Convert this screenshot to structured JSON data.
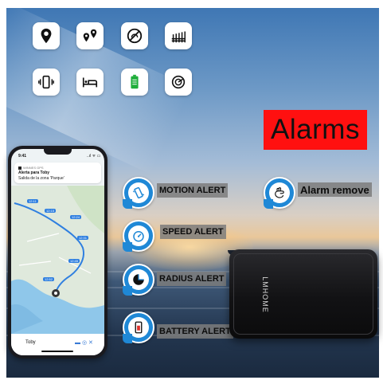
{
  "top_icons": [
    {
      "icon": "location-pin-icon"
    },
    {
      "icon": "multi-location-icon"
    },
    {
      "icon": "no-speeding-icon"
    },
    {
      "icon": "fence-icon"
    },
    {
      "icon": "vibration-icon"
    },
    {
      "icon": "bed-icon"
    },
    {
      "icon": "battery-icon"
    },
    {
      "icon": "radar-icon"
    }
  ],
  "alarms_title": "Alarms",
  "alarms_box_color": "#ff1010",
  "phone": {
    "time": "9:41",
    "status": "..ıl ᯤ ▭",
    "notification": {
      "app": "WINNES GPS",
      "title": "Alerta para Toby",
      "body": "Salida de la zona 'Parque'"
    },
    "map_labels": [
      "12:11",
      "12:15",
      "12:24",
      "12:31",
      "12:45",
      "12:52"
    ],
    "bottom_name": "Toby",
    "bottom_icons": "▬ ◎ ✕"
  },
  "alerts": [
    {
      "label": "MOTION ALERT",
      "icon": "phone-shake-icon"
    },
    {
      "label": "SPEED ALERT",
      "icon": "speedometer-icon"
    },
    {
      "label": "RADIUS ALERT",
      "icon": "radius-icon"
    },
    {
      "label": "BATTERY ALERT",
      "icon": "phone-battery-icon"
    }
  ],
  "alarm_remove": {
    "label": "Alarm remove",
    "icon": "hand-remove-icon"
  },
  "badge_color": "#1f88d6",
  "device_brand": "LMHOME"
}
